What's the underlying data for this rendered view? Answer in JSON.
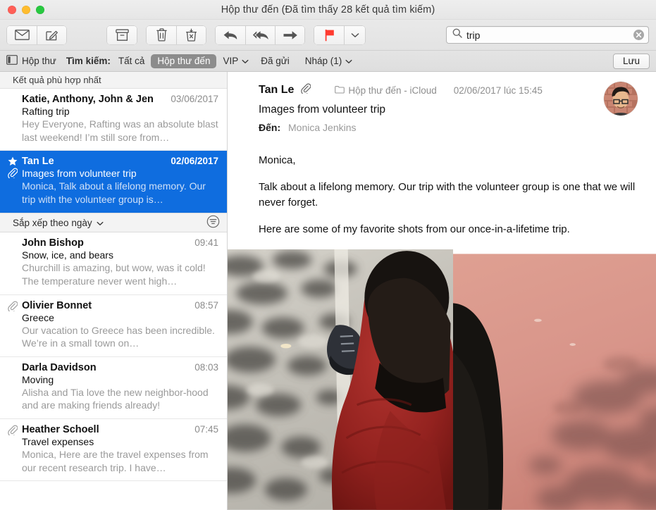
{
  "window": {
    "title": "Hộp thư đến (Đã tìm thấy 28 kết quả tìm kiếm)",
    "traffic": {
      "close": "close",
      "minimize": "minimize",
      "zoom": "zoom"
    }
  },
  "toolbar": {
    "get_mail": "Nhận thư mới",
    "compose": "Soạn thư mới",
    "archive": "Lưu trữ",
    "delete": "Xóa",
    "junk": "Thư rác",
    "reply": "Trả lời",
    "reply_all": "Trả lời tất cả",
    "forward": "Chuyển tiếp",
    "flag": "Cờ",
    "flag_menu": "Menu cờ",
    "flag_color": "#ff3b30"
  },
  "search": {
    "value": "trip",
    "placeholder": "Tìm kiếm",
    "clear": "Xóa"
  },
  "filterbar": {
    "mailbox_button": "Hộp thư",
    "search_label": "Tìm kiếm:",
    "tokens": [
      {
        "label": "Tất cả",
        "selected": false,
        "menu": false
      },
      {
        "label": "Hộp thư đến",
        "selected": true,
        "menu": false
      },
      {
        "label": "VIP",
        "selected": false,
        "menu": true
      },
      {
        "label": "Đã gửi",
        "selected": false,
        "menu": false
      },
      {
        "label": "Nháp (1)",
        "selected": false,
        "menu": true
      }
    ],
    "save_label": "Lưu"
  },
  "message_list": {
    "top_hits_header": "Kết quả phù hợp nhất",
    "sort_label": "Sắp xếp theo ngày",
    "filter_icon": "filter-icon",
    "top_hits": [
      {
        "from": "Katie, Anthony, John & Jen",
        "date": "03/06/2017",
        "subject": "Rafting trip",
        "snippet": "Hey Everyone, Rafting was an absolute blast last weekend! I’m still sore from…",
        "flagged": false,
        "attachment": false,
        "selected": false
      },
      {
        "from": "Tan Le",
        "date": "02/06/2017",
        "subject": "Images from volunteer trip",
        "snippet": "Monica, Talk about a lifelong memory. Our trip with the volunteer group is…",
        "flagged": true,
        "attachment": true,
        "selected": true
      }
    ],
    "messages": [
      {
        "from": "John Bishop",
        "date": "09:41",
        "subject": "Snow, ice, and bears",
        "snippet": "Churchill is amazing, but wow, was it cold! The temperature never went high…",
        "attachment": false,
        "selected": false
      },
      {
        "from": "Olivier Bonnet",
        "date": "08:57",
        "subject": "Greece",
        "snippet": "Our vacation to Greece has been incredible. We’re in a small town on…",
        "attachment": true,
        "selected": false
      },
      {
        "from": "Darla Davidson",
        "date": "08:03",
        "subject": "Moving",
        "snippet": "Alisha and Tia love the new neighbor-hood and are making friends already!",
        "attachment": false,
        "selected": false
      },
      {
        "from": "Heather Schoell",
        "date": "07:45",
        "subject": "Travel expenses",
        "snippet": "Monica, Here are the travel expenses from our recent research trip. I have…",
        "attachment": true,
        "selected": false
      }
    ]
  },
  "detail": {
    "sender": "Tan Le",
    "attachment_icon": "paperclip-icon",
    "mailbox": "Hộp thư đến - iCloud",
    "date": "02/06/2017 lúc 15:45",
    "subject": "Images from volunteer trip",
    "to_label": "Đến:",
    "to_value": "Monica Jenkins",
    "avatar_alt": "Ảnh liên hệ Tan Le",
    "body": [
      "Monica,",
      "Talk about a lifelong memory. Our trip with the volunteer group is one that we will never forget.",
      "Here are some of my favorite shots from our once-in-a-lifetime trip."
    ],
    "attachments": [
      {
        "name": "photo-person-red-shirt-pavement"
      },
      {
        "name": "photo-pink-court-shadows"
      }
    ]
  },
  "colors": {
    "selection_blue": "#0f6ddf",
    "chip_gray": "#8c8c8c",
    "flag_red": "#ff3b30",
    "snippet_gray": "#9a9a9a"
  }
}
